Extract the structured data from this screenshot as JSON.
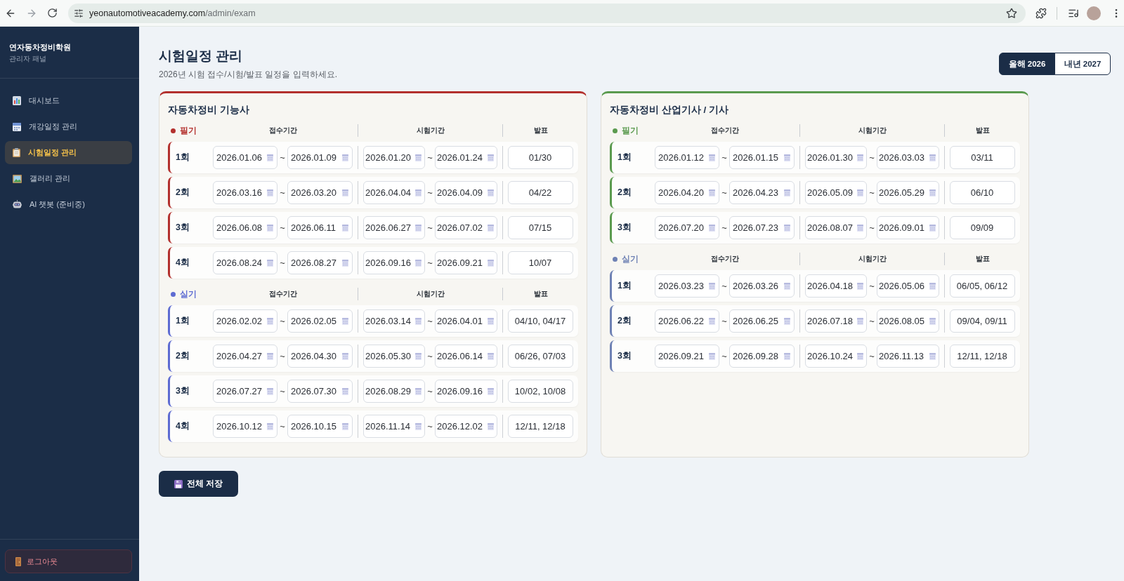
{
  "browser": {
    "url": {
      "host": "yeonautomotiveacademy.com",
      "path": "/admin/exam"
    }
  },
  "sidebar": {
    "brand": {
      "title": "연자동차정비학원",
      "subtitle": "관리자 패널"
    },
    "nav": [
      {
        "label": "대시보드",
        "selected": false
      },
      {
        "label": "개강일정 관리",
        "selected": false
      },
      {
        "label": "시험일정 관리",
        "selected": true
      },
      {
        "label": "갤러리 관리",
        "selected": false
      },
      {
        "label": "AI 챗봇 (준비중)",
        "selected": false
      }
    ],
    "logout": "로그아웃"
  },
  "header": {
    "title": "시험일정 관리",
    "subtitle": "2026년 시험 접수/시험/발표 일정을 입력하세요.",
    "years": [
      {
        "label": "올해 2026",
        "selected": true
      },
      {
        "label": "내년 2027",
        "selected": false
      }
    ]
  },
  "cards": [
    {
      "title": "자동차정비 기능사",
      "sections": [
        {
          "name": "필기",
          "color": "#b3302d",
          "columns": [
            "접수기간",
            "시험기간",
            "발표"
          ],
          "rows": [
            {
              "round": "1회",
              "receipt": {
                "from": "2026.01.06",
                "sep": "~",
                "to": "2026.01.09"
              },
              "exam": {
                "from": "2026.01.20",
                "sep": "~",
                "to": "2026.01.24"
              },
              "announcement": "01/30"
            },
            {
              "round": "2회",
              "receipt": {
                "from": "2026.03.16",
                "sep": "~",
                "to": "2026.03.20"
              },
              "exam": {
                "from": "2026.04.04",
                "sep": "~",
                "to": "2026.04.09"
              },
              "announcement": "04/22"
            },
            {
              "round": "3회",
              "receipt": {
                "from": "2026.06.08",
                "sep": "~",
                "to": "2026.06.11"
              },
              "exam": {
                "from": "2026.06.27",
                "sep": "~",
                "to": "2026.07.02"
              },
              "announcement": "07/15"
            },
            {
              "round": "4회",
              "receipt": {
                "from": "2026.08.24",
                "sep": "~",
                "to": "2026.08.27"
              },
              "exam": {
                "from": "2026.09.16",
                "sep": "~",
                "to": "2026.09.21"
              },
              "announcement": "10/07"
            }
          ]
        },
        {
          "name": "실기",
          "color": "#5d6bd2",
          "columns": [
            "접수기간",
            "시험기간",
            "발표"
          ],
          "rows": [
            {
              "round": "1회",
              "receipt": {
                "from": "2026.02.02",
                "sep": "~",
                "to": "2026.02.05"
              },
              "exam": {
                "from": "2026.03.14",
                "sep": "~",
                "to": "2026.04.01"
              },
              "announcement": "04/10, 04/17"
            },
            {
              "round": "2회",
              "receipt": {
                "from": "2026.04.27",
                "sep": "~",
                "to": "2026.04.30"
              },
              "exam": {
                "from": "2026.05.30",
                "sep": "~",
                "to": "2026.06.14"
              },
              "announcement": "06/26, 07/03"
            },
            {
              "round": "3회",
              "receipt": {
                "from": "2026.07.27",
                "sep": "~",
                "to": "2026.07.30"
              },
              "exam": {
                "from": "2026.08.29",
                "sep": "~",
                "to": "2026.09.16"
              },
              "announcement": "10/02, 10/08"
            },
            {
              "round": "4회",
              "receipt": {
                "from": "2026.10.12",
                "sep": "~",
                "to": "2026.10.15"
              },
              "exam": {
                "from": "2026.11.14",
                "sep": "~",
                "to": "2026.12.02"
              },
              "announcement": "12/11, 12/18"
            }
          ]
        }
      ]
    },
    {
      "title": "자동차정비 산업기사 / 기사",
      "sections": [
        {
          "name": "필기",
          "color": "#5a9a4e",
          "columns": [
            "접수기간",
            "시험기간",
            "발표"
          ],
          "rows": [
            {
              "round": "1회",
              "receipt": {
                "from": "2026.01.12",
                "sep": "~",
                "to": "2026.01.15"
              },
              "exam": {
                "from": "2026.01.30",
                "sep": "~",
                "to": "2026.03.03"
              },
              "announcement": "03/11"
            },
            {
              "round": "2회",
              "receipt": {
                "from": "2026.04.20",
                "sep": "~",
                "to": "2026.04.23"
              },
              "exam": {
                "from": "2026.05.09",
                "sep": "~",
                "to": "2026.05.29"
              },
              "announcement": "06/10"
            },
            {
              "round": "3회",
              "receipt": {
                "from": "2026.07.20",
                "sep": "~",
                "to": "2026.07.23"
              },
              "exam": {
                "from": "2026.08.07",
                "sep": "~",
                "to": "2026.09.01"
              },
              "announcement": "09/09"
            }
          ]
        },
        {
          "name": "실기",
          "color": "#6e81b4",
          "columns": [
            "접수기간",
            "시험기간",
            "발표"
          ],
          "rows": [
            {
              "round": "1회",
              "receipt": {
                "from": "2026.03.23",
                "sep": "~",
                "to": "2026.03.26"
              },
              "exam": {
                "from": "2026.04.18",
                "sep": "~",
                "to": "2026.05.06"
              },
              "announcement": "06/05, 06/12"
            },
            {
              "round": "2회",
              "receipt": {
                "from": "2026.06.22",
                "sep": "~",
                "to": "2026.06.25"
              },
              "exam": {
                "from": "2026.07.18",
                "sep": "~",
                "to": "2026.08.05"
              },
              "announcement": "09/04, 09/11"
            },
            {
              "round": "3회",
              "receipt": {
                "from": "2026.09.21",
                "sep": "~",
                "to": "2026.09.28"
              },
              "exam": {
                "from": "2026.10.24",
                "sep": "~",
                "to": "2026.11.13"
              },
              "announcement": "12/11, 12/18"
            }
          ]
        }
      ]
    }
  ],
  "save_button": "전체 저장"
}
